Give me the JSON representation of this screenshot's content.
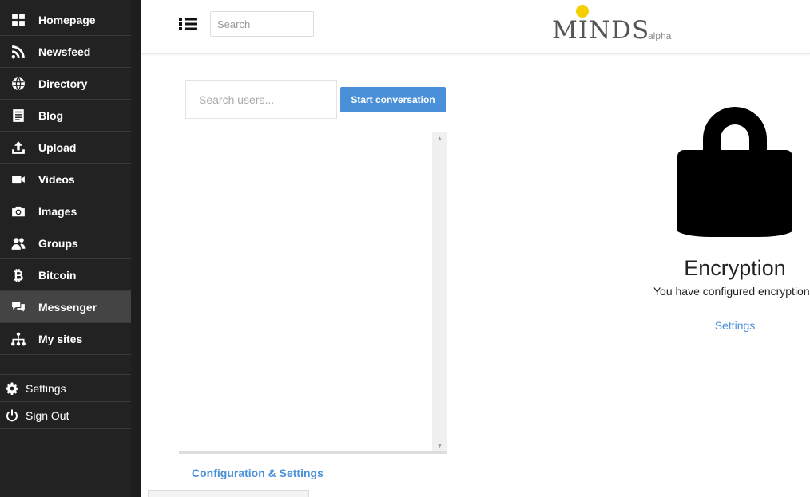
{
  "sidebar": {
    "items": [
      {
        "label": "Homepage",
        "icon": "grid-icon"
      },
      {
        "label": "Newsfeed",
        "icon": "rss-icon"
      },
      {
        "label": "Directory",
        "icon": "globe-icon"
      },
      {
        "label": "Blog",
        "icon": "document-icon"
      },
      {
        "label": "Upload",
        "icon": "upload-icon"
      },
      {
        "label": "Videos",
        "icon": "video-camera-icon"
      },
      {
        "label": "Images",
        "icon": "camera-icon"
      },
      {
        "label": "Groups",
        "icon": "users-icon"
      },
      {
        "label": "Bitcoin",
        "icon": "bitcoin-icon"
      },
      {
        "label": "Messenger",
        "icon": "chat-icon",
        "active": true
      },
      {
        "label": "My sites",
        "icon": "sitemap-icon"
      }
    ],
    "bottom_items": [
      {
        "label": "Settings",
        "icon": "gear-icon"
      },
      {
        "label": "Sign Out",
        "icon": "power-icon"
      }
    ]
  },
  "header": {
    "search_placeholder": "Search",
    "logo_text": "MINDS",
    "logo_badge": "alpha"
  },
  "messenger": {
    "user_search_placeholder": "Search users...",
    "start_button": "Start conversation",
    "config_link": "Configuration & Settings"
  },
  "encryption": {
    "title": "Encryption",
    "description": "You have configured encryption",
    "settings_link": "Settings"
  },
  "colors": {
    "sidebar_bg": "#222222",
    "active_item_bg": "#444444",
    "accent": "#4a90d9"
  }
}
